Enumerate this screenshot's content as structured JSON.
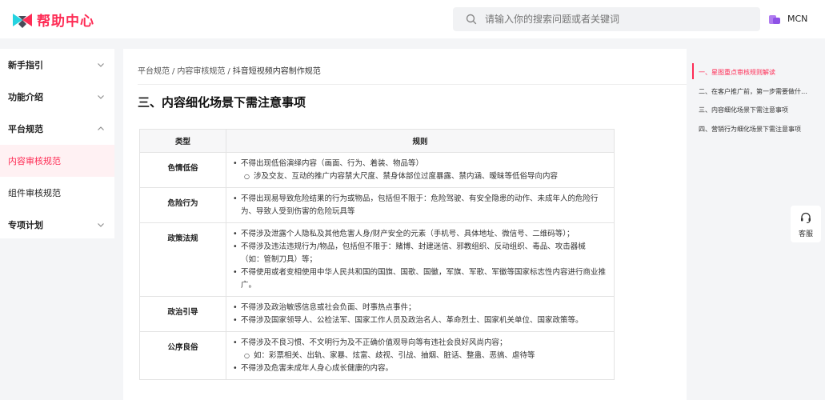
{
  "header": {
    "logo_text": "帮助中心",
    "search_placeholder": "请输入你的搜索问题或者关键词",
    "user_name": "MCN",
    "brand_color": "#fe2c55"
  },
  "sidebar": {
    "items": [
      {
        "label": "新手指引",
        "expanded": false
      },
      {
        "label": "功能介绍",
        "expanded": false
      },
      {
        "label": "平台规范",
        "expanded": true
      },
      {
        "label": "内容审核规范",
        "active": true
      },
      {
        "label": "组件审核规范"
      },
      {
        "label": "专项计划",
        "expanded": false
      }
    ]
  },
  "breadcrumb": [
    "平台规范",
    "内容审核规范",
    "抖音短视频内容制作规范"
  ],
  "page_title": "三、内容细化场景下需注意事项",
  "table": {
    "headers": [
      "类型",
      "规则"
    ],
    "rows": [
      {
        "type": "色情低俗",
        "rules": [
          {
            "text": "不得出现低俗演绎内容（画面、行为、着装、物品等）",
            "sub": [
              "涉及交友、互动的推广内容禁大尺度、禁身体部位过度暴露、禁内涵、暧昧等低俗导向内容"
            ]
          }
        ]
      },
      {
        "type": "危险行为",
        "rules": [
          {
            "text": "不得出现易导致危险结果的行为或物品，包括但不限于：危险驾驶、有安全隐患的动作、未成年人的危险行为、导致人受到伤害的危险玩具等"
          }
        ]
      },
      {
        "type": "政策法规",
        "rules": [
          {
            "text": "不得涉及泄露个人隐私及其他危害人身/财产安全的元素（手机号、具体地址、微信号、二维码等）；"
          },
          {
            "text": "不得涉及违法违规行为/物品，包括但不限于：赌博、封建迷信、邪教组织、反动组织、毒品、攻击器械（如：管制刀具）等；"
          },
          {
            "text": "不得使用或者变相使用中华人民共和国的国旗、国歌、国徽，军旗、军歌、军徽等国家标志性内容进行商业推广。"
          }
        ]
      },
      {
        "type": "政治引导",
        "rules": [
          {
            "text": "不得涉及政治敏感信息或社会负面、时事热点事件；"
          },
          {
            "text": "不得涉及国家领导人、公检法军、国家工作人员及政治名人、革命烈士、国家机关单位、国家政策等。"
          }
        ]
      },
      {
        "type": "公序良俗",
        "rules": [
          {
            "text": "不得涉及不良习惯、不文明行为及不正确价值观导向等有违社会良好风尚内容；",
            "sub": [
              "如：彩票相关、出轨、家暴、炫富、歧视、引战、抽烟、脏话、整蛊、恶搞、虐待等"
            ]
          },
          {
            "text": "不得涉及危害未成年人身心成长健康的内容。"
          }
        ]
      }
    ]
  },
  "toc": [
    {
      "label": "一、星图重点审核规则解读",
      "active": true
    },
    {
      "label": "二、在客户推广前，第一步需要做什…"
    },
    {
      "label": "三、内容细化场景下需注意事项"
    },
    {
      "label": "四、营销行为细化场景下需注意事项"
    }
  ],
  "service": {
    "label": "客服"
  }
}
